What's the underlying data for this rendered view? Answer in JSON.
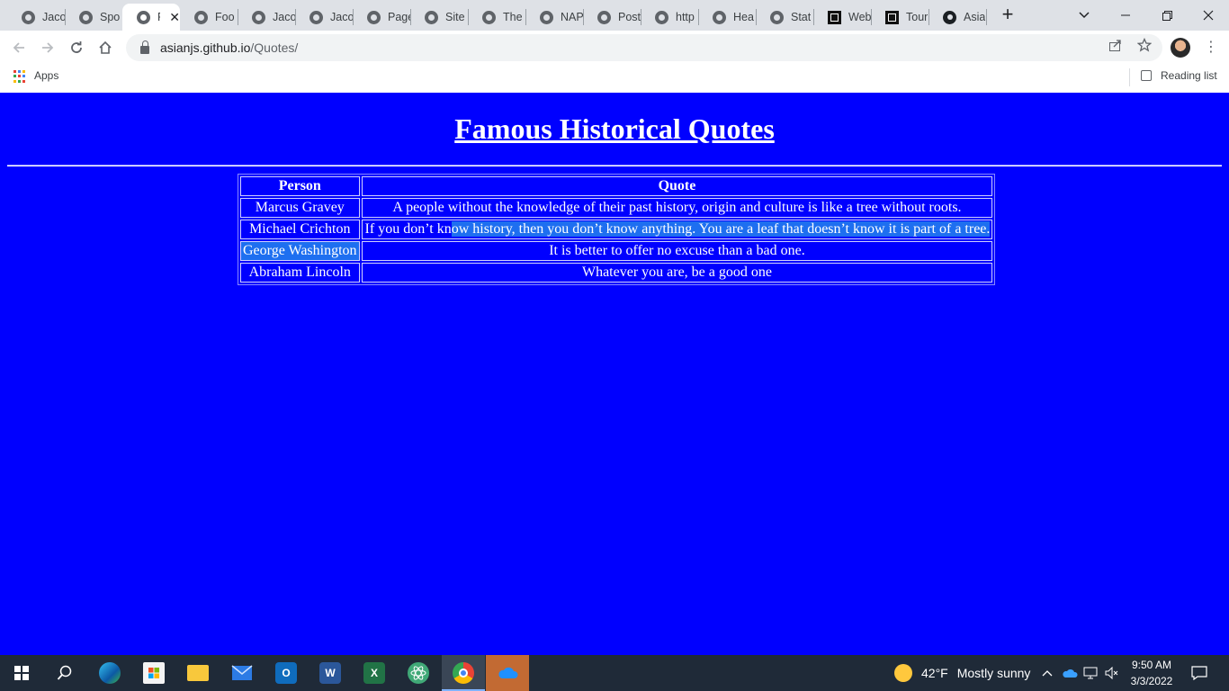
{
  "browser": {
    "tabs": [
      {
        "title": "Jaco",
        "icon": "globe-icon",
        "active": false
      },
      {
        "title": "Spo",
        "icon": "globe-icon",
        "active": false
      },
      {
        "title": "F",
        "icon": "globe-icon",
        "active": true
      },
      {
        "title": "Foo",
        "icon": "globe-icon",
        "active": false
      },
      {
        "title": "Jaco",
        "icon": "globe-icon",
        "active": false
      },
      {
        "title": "Jaco",
        "icon": "globe-icon",
        "active": false
      },
      {
        "title": "Page",
        "icon": "globe-icon",
        "active": false
      },
      {
        "title": "Site",
        "icon": "globe-icon",
        "active": false
      },
      {
        "title": "The",
        "icon": "globe-icon",
        "active": false
      },
      {
        "title": "NAP",
        "icon": "globe-icon",
        "active": false
      },
      {
        "title": "Post",
        "icon": "globe-icon",
        "active": false
      },
      {
        "title": "http",
        "icon": "globe-icon",
        "active": false
      },
      {
        "title": "Hea",
        "icon": "globe-icon",
        "active": false
      },
      {
        "title": "Stat",
        "icon": "globe-icon",
        "active": false
      },
      {
        "title": "Web",
        "icon": "square-icon",
        "active": false
      },
      {
        "title": "Tour",
        "icon": "square-icon",
        "active": false
      },
      {
        "title": "Asia",
        "icon": "github-icon",
        "active": false
      }
    ],
    "url_host": "asianjs.github.io",
    "url_path": "/Quotes/",
    "bookmarks": {
      "apps_label": "Apps",
      "reading_list_label": "Reading list"
    }
  },
  "page": {
    "title": "Famous Historical Quotes",
    "table": {
      "headers": [
        "Person",
        "Quote"
      ],
      "rows": [
        {
          "person": "Marcus Gravey",
          "quote": "A people without the knowledge of their past history, origin and culture is like a tree without roots."
        },
        {
          "person": "Michael Crichton",
          "quote_pre": "If you don’t kn",
          "quote_sel": "ow history, then you don’t know anything. You are a leaf that doesn’t know it is part of a tree."
        },
        {
          "person": "George Washington",
          "quote": "It is better to offer no excuse than a bad one."
        },
        {
          "person": "Abraham Lincoln",
          "quote": "Whatever you are, be a good one"
        }
      ]
    }
  },
  "taskbar": {
    "weather_temp": "42°F",
    "weather_desc": "Mostly sunny",
    "time": "9:50 AM",
    "date": "3/3/2022"
  },
  "colors": {
    "page_background": "#0000ff",
    "selection": "#1e6ff0"
  }
}
